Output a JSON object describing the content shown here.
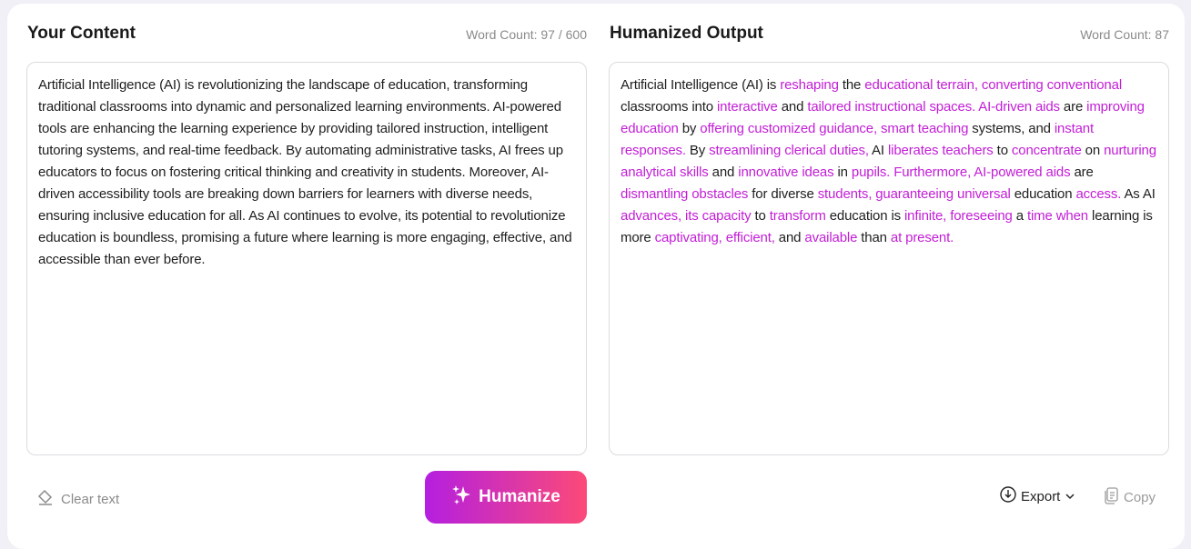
{
  "input": {
    "title": "Your Content",
    "word_count": "Word Count: 97 / 600",
    "text": "Artificial Intelligence (AI) is revolutionizing the landscape of education, transforming traditional classrooms into dynamic and personalized learning environments. AI-powered tools are enhancing the learning experience by providing tailored instruction, intelligent tutoring systems, and real-time feedback. By automating administrative tasks, AI frees up educators to focus on fostering critical thinking and creativity in students. Moreover, AI-driven accessibility tools are breaking down barriers for learners with diverse needs, ensuring inclusive education for all. As AI continues to evolve, its potential to revolutionize education is boundless, promising a future where learning is more engaging, effective, and accessible than ever before.",
    "clear_label": "Clear text",
    "humanize_label": "Humanize"
  },
  "output": {
    "title": "Humanized Output",
    "word_count": "Word Count: 87",
    "highlight_color": "#c21ed6",
    "segments": [
      {
        "t": "Artificial Intelligence (AI) is ",
        "h": false
      },
      {
        "t": "reshaping",
        "h": true
      },
      {
        "t": " the ",
        "h": false
      },
      {
        "t": "educational terrain, converting conventional",
        "h": true
      },
      {
        "t": " classrooms into ",
        "h": false
      },
      {
        "t": "interactive",
        "h": true
      },
      {
        "t": " and ",
        "h": false
      },
      {
        "t": "tailored instructional spaces. AI-driven aids",
        "h": true
      },
      {
        "t": " are ",
        "h": false
      },
      {
        "t": "improving education",
        "h": true
      },
      {
        "t": " by ",
        "h": false
      },
      {
        "t": "offering customized guidance, smart teaching",
        "h": true
      },
      {
        "t": " systems, and ",
        "h": false
      },
      {
        "t": "instant responses.",
        "h": true
      },
      {
        "t": " By ",
        "h": false
      },
      {
        "t": "streamlining clerical duties,",
        "h": true
      },
      {
        "t": " AI ",
        "h": false
      },
      {
        "t": "liberates teachers",
        "h": true
      },
      {
        "t": " to ",
        "h": false
      },
      {
        "t": "concentrate",
        "h": true
      },
      {
        "t": " on ",
        "h": false
      },
      {
        "t": "nurturing analytical skills",
        "h": true
      },
      {
        "t": " and ",
        "h": false
      },
      {
        "t": "innovative ideas",
        "h": true
      },
      {
        "t": " in ",
        "h": false
      },
      {
        "t": "pupils. Furthermore, AI-powered aids",
        "h": true
      },
      {
        "t": " are ",
        "h": false
      },
      {
        "t": "dismantling obstacles",
        "h": true
      },
      {
        "t": " for diverse ",
        "h": false
      },
      {
        "t": "students, guaranteeing universal",
        "h": true
      },
      {
        "t": " education ",
        "h": false
      },
      {
        "t": "access.",
        "h": true
      },
      {
        "t": " As AI ",
        "h": false
      },
      {
        "t": "advances, its capacity",
        "h": true
      },
      {
        "t": " to ",
        "h": false
      },
      {
        "t": "transform",
        "h": true
      },
      {
        "t": " education is ",
        "h": false
      },
      {
        "t": "infinite, foreseeing",
        "h": true
      },
      {
        "t": " a ",
        "h": false
      },
      {
        "t": "time when",
        "h": true
      },
      {
        "t": " learning is more ",
        "h": false
      },
      {
        "t": "captivating, efficient,",
        "h": true
      },
      {
        "t": " and ",
        "h": false
      },
      {
        "t": "available",
        "h": true
      },
      {
        "t": " than ",
        "h": false
      },
      {
        "t": "at present.",
        "h": true
      }
    ],
    "export_label": "Export",
    "copy_label": "Copy"
  }
}
